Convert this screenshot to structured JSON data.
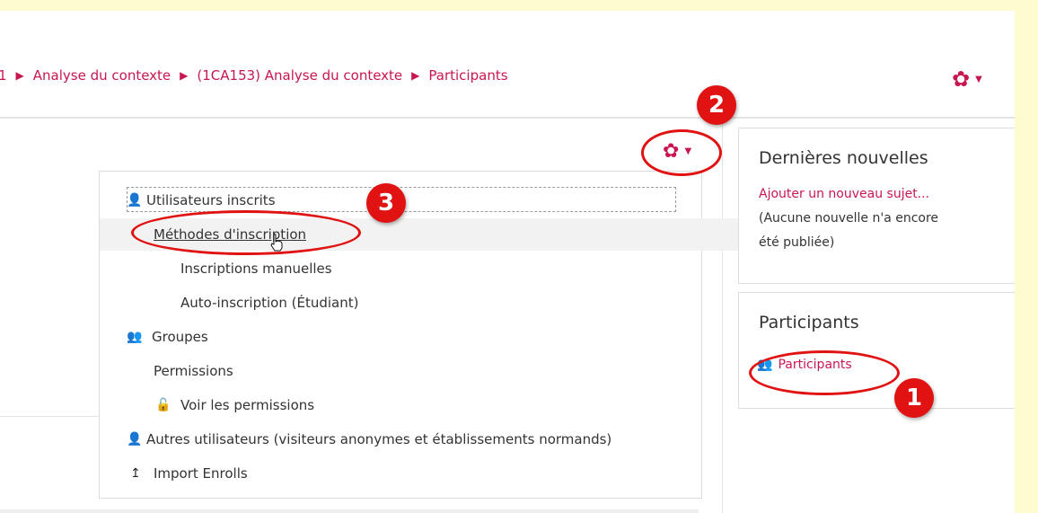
{
  "breadcrumb": {
    "items": [
      "1",
      "Analyse du contexte",
      "(1CA153) Analyse du contexte",
      "Participants"
    ],
    "separator": "▶"
  },
  "menu": {
    "items": [
      {
        "label": "Utilisateurs inscrits",
        "icon": "user-plus-icon"
      },
      {
        "label": "Méthodes d'inscription",
        "icon": ""
      },
      {
        "label": "Inscriptions manuelles",
        "icon": ""
      },
      {
        "label": "Auto-inscription (Étudiant)",
        "icon": ""
      },
      {
        "label": "Groupes",
        "icon": "users-icon"
      },
      {
        "label": "Permissions",
        "icon": ""
      },
      {
        "label": "Voir les permissions",
        "icon": "unlock-icon"
      },
      {
        "label": "Autres utilisateurs (visiteurs anonymes et établissements normands)",
        "icon": "user-plus-icon"
      },
      {
        "label": "Import Enrolls",
        "icon": "upload-arrow-icon"
      }
    ]
  },
  "news_block": {
    "title": "Dernières nouvelles",
    "add_link": "Ajouter un nouveau sujet...",
    "empty_line1": "(Aucune nouvelle n'a encore",
    "empty_line2": "été publiée)"
  },
  "participants_block": {
    "title": "Participants",
    "link": "Participants"
  },
  "callouts": [
    "1",
    "2",
    "3"
  ],
  "colors": {
    "accent": "#c8174f",
    "callout": "#e01212",
    "frame_bg": "#fffbd0"
  }
}
